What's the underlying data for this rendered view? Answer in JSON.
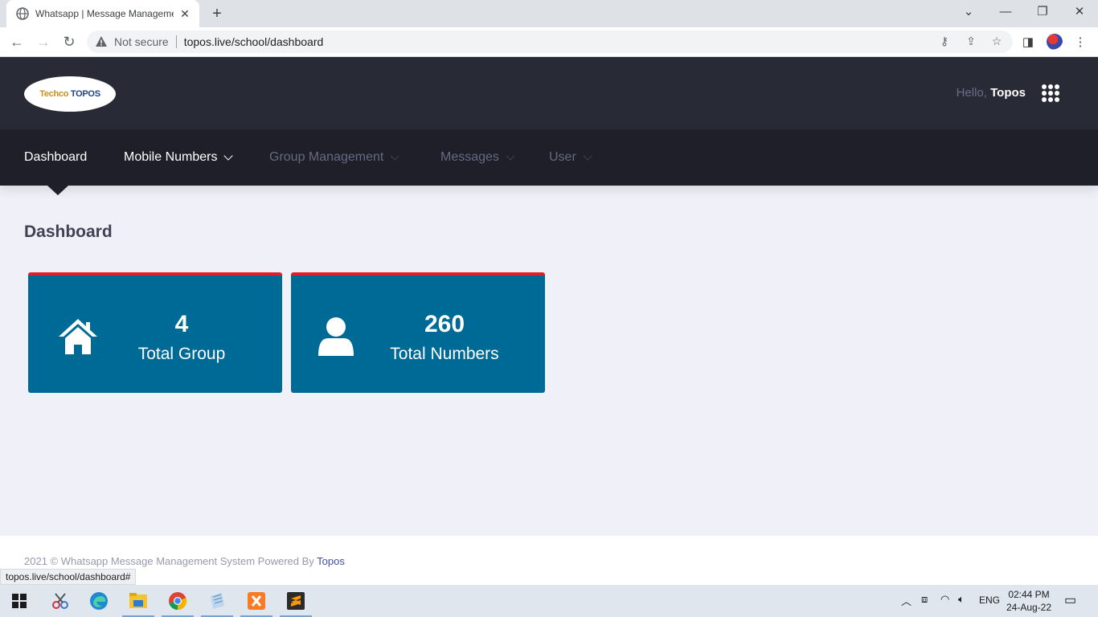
{
  "browser": {
    "tab_title": "Whatsapp | Message Manageme",
    "not_secure": "Not secure",
    "url": "topos.live/school/dashboard",
    "status_url": "topos.live/school/dashboard#"
  },
  "header": {
    "logo_text_a": "Techco",
    "logo_text_b": "TOPOS",
    "greeting": "Hello,",
    "username": "Topos"
  },
  "menu": {
    "items": [
      {
        "label": "Dashboard",
        "active": true
      },
      {
        "label": "Mobile Numbers",
        "has_dropdown": true
      },
      {
        "label": "Group Management",
        "has_dropdown": true
      },
      {
        "label": "Messages",
        "has_dropdown": true
      },
      {
        "label": "User",
        "has_dropdown": true
      }
    ]
  },
  "main": {
    "title": "Dashboard",
    "cards": [
      {
        "value": "4",
        "label": "Total Group",
        "icon": "home-icon"
      },
      {
        "value": "260",
        "label": "Total Numbers",
        "icon": "user-icon"
      }
    ]
  },
  "footer": {
    "text": "2021 © Whatsapp Message Management System Powered By",
    "link": "Topos"
  },
  "taskbar": {
    "lang": "ENG",
    "time": "02:44 PM",
    "date": "24-Aug-22"
  },
  "colors": {
    "header_bg": "#282a36",
    "menu_bg": "#1e1f29",
    "card_bg": "#006a96",
    "card_accent": "#e11d2a"
  }
}
